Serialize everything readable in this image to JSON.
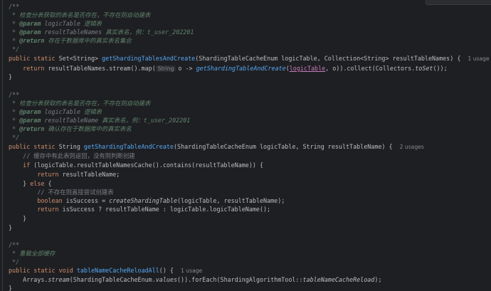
{
  "code": {
    "block1": {
      "doc_open": "/**",
      "doc_desc": " * 检查分表获取的表名是否存在，不存在则自动建表",
      "param1_tag": "@param",
      "param1_name": "logicTable",
      "param1_desc": "逻辑表",
      "param2_tag": "@param",
      "param2_name": "resultTableNames",
      "param2_desc": "真实表名，例：t_user_202201",
      "return_tag": "@return",
      "return_desc": "存在于数据库中的真实表名集合",
      "doc_close": " */",
      "sig_mod": "public static",
      "sig_type": "Set<String>",
      "sig_name": "getShardingTablesAndCreate",
      "sig_params": "(ShardingTableCacheEnum logicTable, Collection<String> resultTableNames) {",
      "usage": "1 usage",
      "body_return": "return",
      "body_1": "resultTableNames.stream().map(",
      "hint_type": "String",
      "body_2": "o -> ",
      "body_call": "getShardingTableAndCreate",
      "body_3": "(",
      "body_lp": "logicTable",
      "body_4": ", o)).collect(Collectors.",
      "body_toset": "toSet",
      "body_5": "());",
      "close": "}"
    },
    "block2": {
      "doc_open": "/**",
      "doc_desc": " * 检查分表获取的表名是否存在，不存在则自动建表",
      "param1_tag": "@param",
      "param1_name": "logicTable",
      "param1_desc": "逻辑表",
      "param2_tag": "@param",
      "param2_name": "resultTableName",
      "param2_desc": "真实表名，例：t_user_202201",
      "return_tag": "@return",
      "return_desc": "确认存在于数据库中的真实表名",
      "doc_close": " */",
      "sig_mod": "public static",
      "sig_type": "String",
      "sig_name": "getShardingTableAndCreate",
      "sig_params": "(ShardingTableCacheEnum logicTable, String resultTableName) {",
      "usage": "2 usages",
      "comment1": "// 缓存中有此表则返回，没有则判断创建",
      "if_kw": "if",
      "if_cond": " (logicTable.resultTableNamesCache().contains(resultTableName)) {",
      "ret1_kw": "return",
      "ret1_val": " resultTableName;",
      "else_open": "} ",
      "else_kw": "else",
      "else_brace": " {",
      "comment2": "// 不存在则直接尝试创建表",
      "bool_kw": "boolean",
      "bool_1": " isSuccess = ",
      "bool_call": "createShardingTable",
      "bool_2": "(logicTable, resultTableName);",
      "ret2_kw": "return",
      "ret2_val": " isSuccess ? resultTableName : logicTable.logicTableName();",
      "inner_close": "}",
      "close": "}"
    },
    "block3": {
      "doc_open": "/**",
      "doc_desc": " * 重载全部缓存",
      "doc_close": " */",
      "sig_mod": "public static void",
      "sig_name": "tableNameCacheReloadAll",
      "sig_params": "() {",
      "usage": "1 usage",
      "body_1": "Arrays.",
      "body_stream": "stream",
      "body_2": "(ShardingTableCacheEnum.",
      "body_values": "values",
      "body_3": "()).forEach(ShardingAlgorithmTool::",
      "body_ref": "tableNameCacheReload",
      "body_4": ");",
      "close": "}"
    }
  },
  "colors": {
    "background": "#1e1f22",
    "keyword": "#cf8e6d",
    "function": "#56a8f5",
    "comment": "#7a7e85",
    "javadoc": "#5f826b",
    "parameter": "#c77dbb",
    "text": "#bcbec4"
  }
}
